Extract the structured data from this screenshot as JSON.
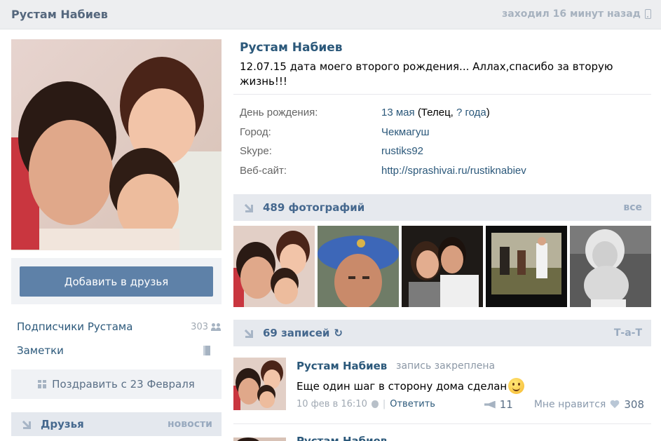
{
  "header": {
    "name": "Рустам Набиев",
    "last_seen": "заходил 16 минут назад"
  },
  "left": {
    "add_friend_label": "Добавить в друзья",
    "subscribers_label": "Подписчики Рустама",
    "subscribers_count": "303",
    "notes_label": "Заметки",
    "congratulate_label": "Поздравить с 23 Февраля",
    "friends_title": "Друзья",
    "friends_more": "новости"
  },
  "profile": {
    "name": "Рустам Набиев",
    "status": "12.07.15 дата моего второго рождения... Аллах,спасибо за вторую жизнь!!!",
    "info": {
      "birthday_label": "День рождения:",
      "birthday_date": "13 мая",
      "birthday_sign_prefix": "(Телец,",
      "birthday_age": "? года",
      "birthday_suffix": ")",
      "city_label": "Город:",
      "city_value": "Чекмагуш",
      "skype_label": "Skype:",
      "skype_value": "rustiks92",
      "website_label": "Веб-сайт:",
      "website_value": "http://sprashivai.ru/rustiknabiev"
    }
  },
  "photos": {
    "title": "489 фотографий",
    "all_label": "все"
  },
  "wall": {
    "title": "69 записей",
    "owner_link": "Т-а-Т",
    "post": {
      "author": "Рустам Набиев",
      "pinned": "запись закреплена",
      "text": "Еще один шаг в сторону дома сделан",
      "date": "10 фев в 16:10",
      "reply_label": "Ответить",
      "shares": "11",
      "like_label": "Мне нравится",
      "likes": "308"
    },
    "next_author": "Рустам Набиев"
  },
  "colors": {
    "accent": "#5e81a8",
    "link": "#2b587a",
    "bar": "#e6e9ee"
  }
}
